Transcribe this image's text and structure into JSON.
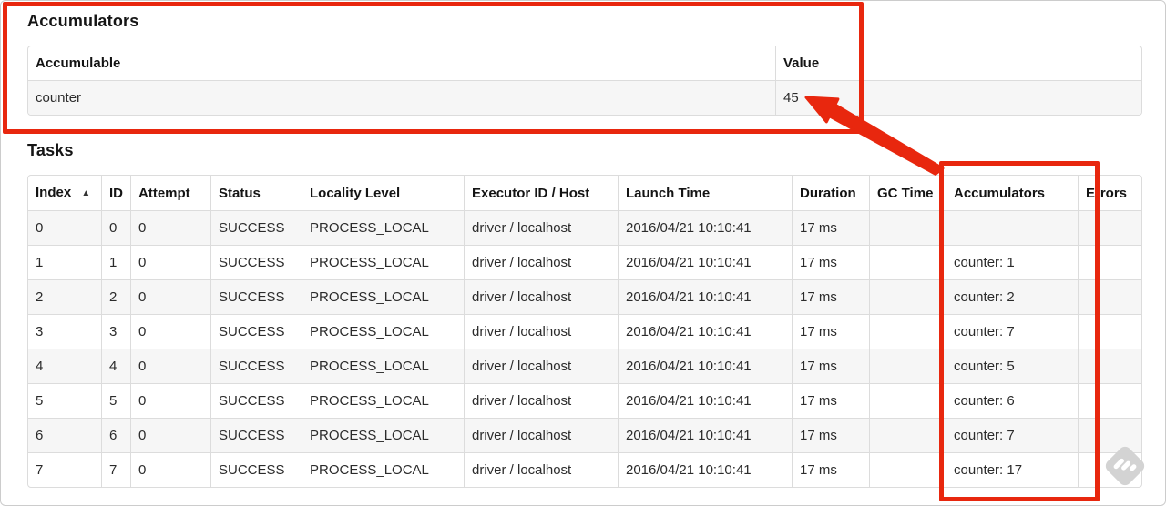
{
  "accumulators_section": {
    "title": "Accumulators",
    "table": {
      "headers": [
        "Accumulable",
        "Value"
      ],
      "rows": [
        [
          "counter",
          "45"
        ]
      ]
    }
  },
  "tasks_section": {
    "title": "Tasks",
    "table": {
      "sort_icon": "▲",
      "headers": [
        "Index",
        "ID",
        "Attempt",
        "Status",
        "Locality Level",
        "Executor ID / Host",
        "Launch Time",
        "Duration",
        "GC Time",
        "Accumulators",
        "Errors"
      ],
      "rows": [
        [
          "0",
          "0",
          "0",
          "SUCCESS",
          "PROCESS_LOCAL",
          "driver / localhost",
          "2016/04/21 10:10:41",
          "17 ms",
          "",
          "",
          ""
        ],
        [
          "1",
          "1",
          "0",
          "SUCCESS",
          "PROCESS_LOCAL",
          "driver / localhost",
          "2016/04/21 10:10:41",
          "17 ms",
          "",
          "counter: 1",
          ""
        ],
        [
          "2",
          "2",
          "0",
          "SUCCESS",
          "PROCESS_LOCAL",
          "driver / localhost",
          "2016/04/21 10:10:41",
          "17 ms",
          "",
          "counter: 2",
          ""
        ],
        [
          "3",
          "3",
          "0",
          "SUCCESS",
          "PROCESS_LOCAL",
          "driver / localhost",
          "2016/04/21 10:10:41",
          "17 ms",
          "",
          "counter: 7",
          ""
        ],
        [
          "4",
          "4",
          "0",
          "SUCCESS",
          "PROCESS_LOCAL",
          "driver / localhost",
          "2016/04/21 10:10:41",
          "17 ms",
          "",
          "counter: 5",
          ""
        ],
        [
          "5",
          "5",
          "0",
          "SUCCESS",
          "PROCESS_LOCAL",
          "driver / localhost",
          "2016/04/21 10:10:41",
          "17 ms",
          "",
          "counter: 6",
          ""
        ],
        [
          "6",
          "6",
          "0",
          "SUCCESS",
          "PROCESS_LOCAL",
          "driver / localhost",
          "2016/04/21 10:10:41",
          "17 ms",
          "",
          "counter: 7",
          ""
        ],
        [
          "7",
          "7",
          "0",
          "SUCCESS",
          "PROCESS_LOCAL",
          "driver / localhost",
          "2016/04/21 10:10:41",
          "17 ms",
          "",
          "counter: 17",
          ""
        ]
      ]
    }
  },
  "annotations": {
    "highlight_color": "#e8270e"
  }
}
